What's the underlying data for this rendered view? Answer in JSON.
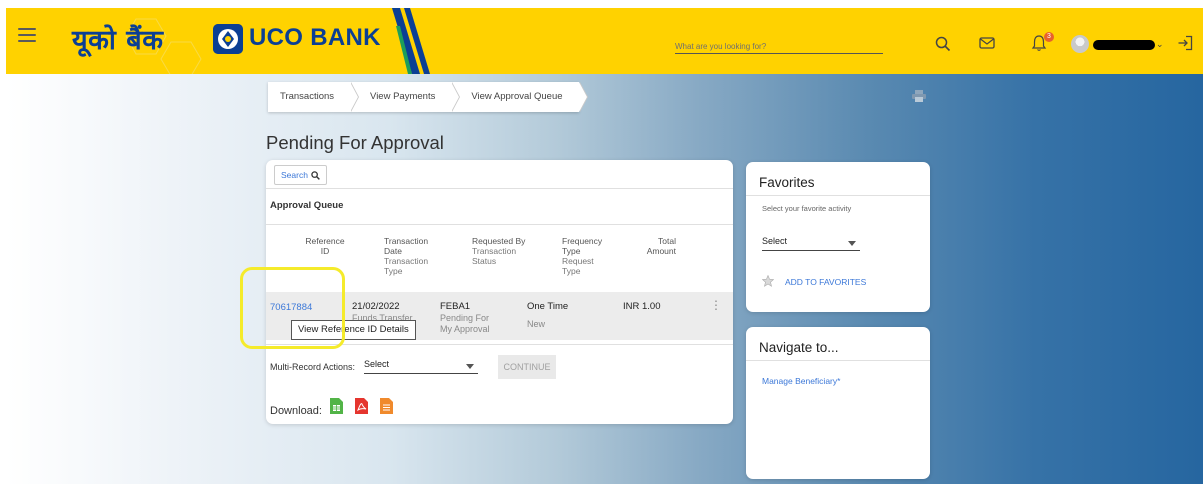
{
  "header": {
    "brand_hindi": "यूको बैंक",
    "brand_name": "UCO BANK",
    "search_placeholder": "What are you looking for?",
    "notification_count": "3"
  },
  "breadcrumb": [
    "Transactions",
    "View Payments",
    "View Approval Queue"
  ],
  "page_title": "Pending For Approval",
  "approval": {
    "search_label": "Search",
    "section_title": "Approval Queue",
    "columns": [
      {
        "label": "Reference ID",
        "sub": ""
      },
      {
        "label": "Transaction Date",
        "sub": "Transaction Type"
      },
      {
        "label": "Requested By",
        "sub": "Transaction Status"
      },
      {
        "label": "Frequency Type",
        "sub": "Request Type"
      },
      {
        "label": "Total Amount",
        "sub": ""
      }
    ],
    "row": {
      "reference_id": "70617884",
      "date": "21/02/2022",
      "transaction_type": "Funds Transfer",
      "requested_by": "FEBA1",
      "status": "Pending For My Approval",
      "frequency": "One Time",
      "request_type": "New",
      "amount": "INR 1.00"
    },
    "tooltip": "View Reference ID Details",
    "multi_record_label": "Multi-Record Actions:",
    "multi_record_value": "Select",
    "continue_label": "CONTINUE",
    "download_label": "Download:"
  },
  "favorites": {
    "title": "Favorites",
    "note": "Select your favorite activity",
    "select_value": "Select",
    "add_label": "ADD TO FAVORITES"
  },
  "navigate": {
    "title": "Navigate to...",
    "link": "Manage Beneficiary*"
  },
  "colors": {
    "header_bg": "#ffd200",
    "brand_blue": "#0b3f94",
    "link_blue": "#3c78d8",
    "highlight_yellow": "#f5eb2b"
  },
  "icons": [
    "menu-icon",
    "search-icon",
    "mail-icon",
    "bell-icon",
    "logout-icon",
    "print-icon",
    "star-icon",
    "excel-icon",
    "pdf-icon",
    "doc-icon"
  ]
}
